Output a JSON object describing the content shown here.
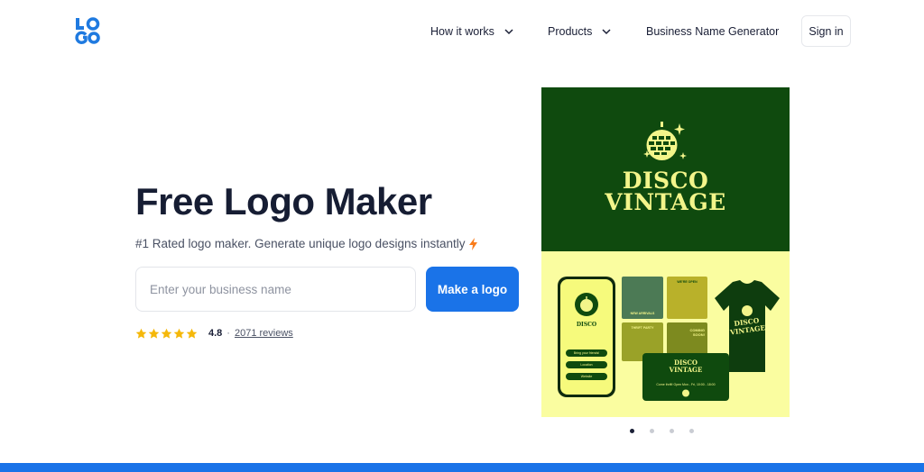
{
  "header": {
    "logo_text": "LOGO",
    "nav": [
      {
        "label": "How it works",
        "has_dropdown": true
      },
      {
        "label": "Products",
        "has_dropdown": true
      },
      {
        "label": "Business Name Generator",
        "has_dropdown": false
      }
    ],
    "signin_label": "Sign in"
  },
  "hero": {
    "title": "Free Logo Maker",
    "subtitle": "#1 Rated logo maker. Generate unique logo designs instantly",
    "input_placeholder": "Enter your business name",
    "cta_label": "Make a logo",
    "rating": {
      "stars": 5,
      "score": "4.8",
      "separator": "·",
      "reviews": "2071 reviews"
    }
  },
  "showcase": {
    "brand_line1": "DISCO",
    "brand_line2": "VINTAGE",
    "phone_name": "DISCO",
    "phone_buttons": [
      "Bring your friends!",
      "Location",
      "Website"
    ],
    "card_name_1": "DISCO",
    "card_name_2": "VINTAGE",
    "card_line": "Come thrift! Open Mon - Fri, 10:00 - 18:00",
    "tiles": [
      "NEW ARRIVALS",
      "WE'RE OPEN",
      "THRIFT PARTY",
      "COMING SOON!"
    ],
    "shirt_line1": "DISCO",
    "shirt_line2": "VINTAGE"
  },
  "carousel": {
    "count": 4,
    "active_index": 0
  },
  "colors": {
    "primary": "#1a73e8",
    "logo_blue": "#1f7ae0",
    "brand_green": "#0f4a0e",
    "brand_yellow": "#f3f58a",
    "light_yellow": "#fafda0",
    "star": "#f5b80a",
    "bolt": "#f97c1b"
  }
}
